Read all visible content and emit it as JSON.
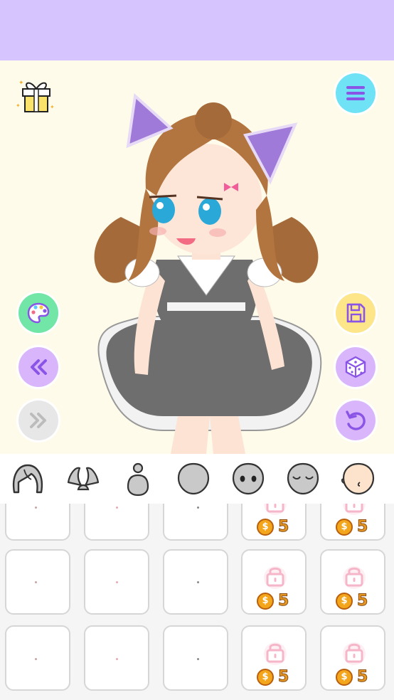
{
  "colors": {
    "topbar": "#d5c4fd",
    "stage_bg": "#fffbea",
    "menu_btn": "#6fe3f5",
    "palette_btn": "#71e6a6",
    "save_btn": "#fde58a",
    "action_btn": "#d9b6fb",
    "disabled_btn": "#e7e7e7",
    "lock": "#f4b6c8",
    "coin": "#f3a51b"
  },
  "stage": {
    "left_buttons": [
      "palette-icon",
      "rewind-icon",
      "fast-forward-icon"
    ],
    "right_buttons": [
      "save-icon",
      "dice-icon",
      "undo-icon"
    ],
    "top_left": "gift-icon",
    "top_right": "menu-icon"
  },
  "tabs": [
    {
      "name": "hair-tab",
      "icon": "hair-icon"
    },
    {
      "name": "ears-tab",
      "icon": "bunny-ears-icon"
    },
    {
      "name": "body-tab",
      "icon": "body-icon"
    },
    {
      "name": "head-tab",
      "icon": "head-shape-icon"
    },
    {
      "name": "eyes-tab",
      "icon": "eyes-face-icon"
    },
    {
      "name": "expression-tab",
      "icon": "sleepy-face-icon"
    },
    {
      "name": "face-tab",
      "icon": "face-icon",
      "selected": true
    }
  ],
  "items": {
    "coin_symbol": "$",
    "price": "5",
    "rows": 3,
    "columns": 5,
    "locked_columns": [
      3,
      4
    ]
  }
}
